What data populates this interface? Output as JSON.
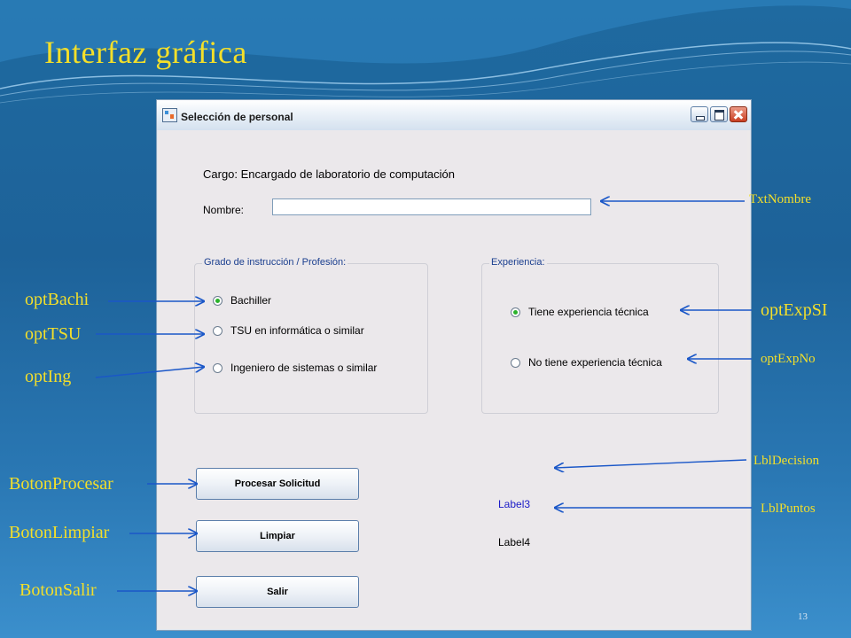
{
  "slide": {
    "title": "Interfaz gráfica",
    "page_number": "13"
  },
  "window": {
    "title": "Selección de personal",
    "cargo": "Cargo: Encargado de laboratorio de computación",
    "nombre_label": "Nombre:",
    "nombre_value": "",
    "grado_group": {
      "legend": "Grado de instrucción / Profesión:",
      "options": [
        {
          "label": "Bachiller",
          "checked": true
        },
        {
          "label": "TSU en informática o similar",
          "checked": false
        },
        {
          "label": "Ingeniero de sistemas o similar",
          "checked": false
        }
      ]
    },
    "exp_group": {
      "legend": "Experiencia:",
      "options": [
        {
          "label": "Tiene experiencia técnica",
          "checked": true
        },
        {
          "label": "No tiene experiencia técnica",
          "checked": false
        }
      ]
    },
    "buttons": {
      "procesar": "Procesar Solicitud",
      "limpiar": "Limpiar",
      "salir": "Salir"
    },
    "label3": "Label3",
    "label4": "Label4"
  },
  "annotations": {
    "txt_nombre": "TxtNombre",
    "opt_bachi": "optBachi",
    "opt_tsu": "optTSU",
    "opt_ing": "optIng",
    "opt_exp_si": "optExpSI",
    "opt_exp_no": "optExpNo",
    "lbl_decision": "LblDecision",
    "lbl_puntos": "LblPuntos",
    "boton_procesar": "BotonProcesar",
    "boton_limpiar": "BotonLimpiar",
    "boton_salir": "BotonSalir"
  },
  "colors": {
    "annotation": "#f3df2a",
    "label3": "#1c1cc8",
    "background": "#1f6aa0"
  }
}
